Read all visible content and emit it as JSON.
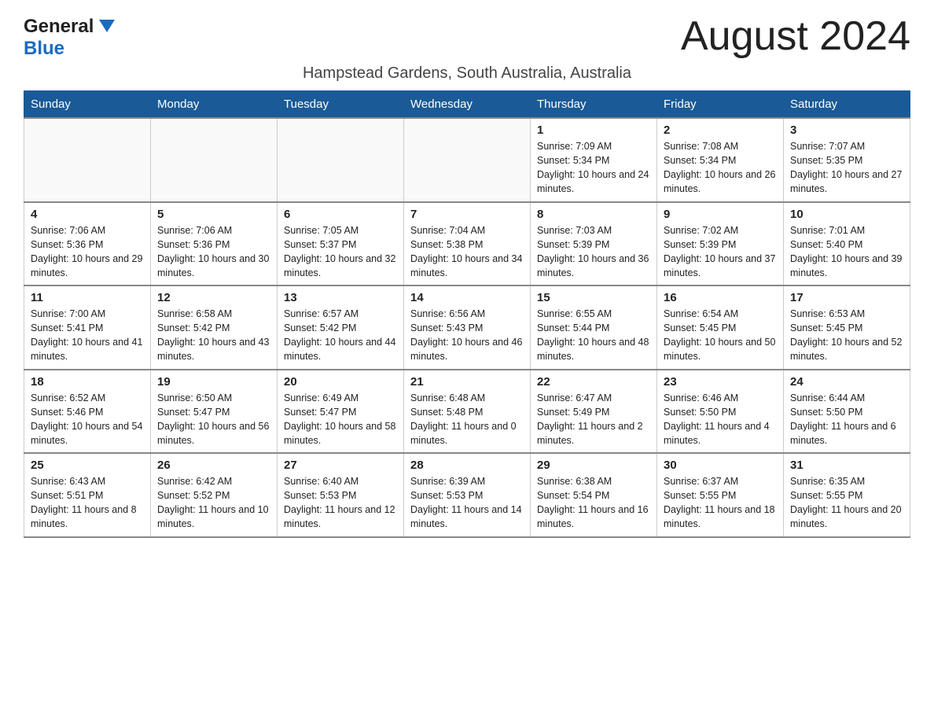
{
  "logo": {
    "text_general": "General",
    "text_blue": "Blue"
  },
  "header": {
    "month_year": "August 2024",
    "location": "Hampstead Gardens, South Australia, Australia"
  },
  "days_of_week": [
    "Sunday",
    "Monday",
    "Tuesday",
    "Wednesday",
    "Thursday",
    "Friday",
    "Saturday"
  ],
  "weeks": [
    {
      "days": [
        {
          "num": "",
          "info": ""
        },
        {
          "num": "",
          "info": ""
        },
        {
          "num": "",
          "info": ""
        },
        {
          "num": "",
          "info": ""
        },
        {
          "num": "1",
          "info": "Sunrise: 7:09 AM\nSunset: 5:34 PM\nDaylight: 10 hours and 24 minutes."
        },
        {
          "num": "2",
          "info": "Sunrise: 7:08 AM\nSunset: 5:34 PM\nDaylight: 10 hours and 26 minutes."
        },
        {
          "num": "3",
          "info": "Sunrise: 7:07 AM\nSunset: 5:35 PM\nDaylight: 10 hours and 27 minutes."
        }
      ]
    },
    {
      "days": [
        {
          "num": "4",
          "info": "Sunrise: 7:06 AM\nSunset: 5:36 PM\nDaylight: 10 hours and 29 minutes."
        },
        {
          "num": "5",
          "info": "Sunrise: 7:06 AM\nSunset: 5:36 PM\nDaylight: 10 hours and 30 minutes."
        },
        {
          "num": "6",
          "info": "Sunrise: 7:05 AM\nSunset: 5:37 PM\nDaylight: 10 hours and 32 minutes."
        },
        {
          "num": "7",
          "info": "Sunrise: 7:04 AM\nSunset: 5:38 PM\nDaylight: 10 hours and 34 minutes."
        },
        {
          "num": "8",
          "info": "Sunrise: 7:03 AM\nSunset: 5:39 PM\nDaylight: 10 hours and 36 minutes."
        },
        {
          "num": "9",
          "info": "Sunrise: 7:02 AM\nSunset: 5:39 PM\nDaylight: 10 hours and 37 minutes."
        },
        {
          "num": "10",
          "info": "Sunrise: 7:01 AM\nSunset: 5:40 PM\nDaylight: 10 hours and 39 minutes."
        }
      ]
    },
    {
      "days": [
        {
          "num": "11",
          "info": "Sunrise: 7:00 AM\nSunset: 5:41 PM\nDaylight: 10 hours and 41 minutes."
        },
        {
          "num": "12",
          "info": "Sunrise: 6:58 AM\nSunset: 5:42 PM\nDaylight: 10 hours and 43 minutes."
        },
        {
          "num": "13",
          "info": "Sunrise: 6:57 AM\nSunset: 5:42 PM\nDaylight: 10 hours and 44 minutes."
        },
        {
          "num": "14",
          "info": "Sunrise: 6:56 AM\nSunset: 5:43 PM\nDaylight: 10 hours and 46 minutes."
        },
        {
          "num": "15",
          "info": "Sunrise: 6:55 AM\nSunset: 5:44 PM\nDaylight: 10 hours and 48 minutes."
        },
        {
          "num": "16",
          "info": "Sunrise: 6:54 AM\nSunset: 5:45 PM\nDaylight: 10 hours and 50 minutes."
        },
        {
          "num": "17",
          "info": "Sunrise: 6:53 AM\nSunset: 5:45 PM\nDaylight: 10 hours and 52 minutes."
        }
      ]
    },
    {
      "days": [
        {
          "num": "18",
          "info": "Sunrise: 6:52 AM\nSunset: 5:46 PM\nDaylight: 10 hours and 54 minutes."
        },
        {
          "num": "19",
          "info": "Sunrise: 6:50 AM\nSunset: 5:47 PM\nDaylight: 10 hours and 56 minutes."
        },
        {
          "num": "20",
          "info": "Sunrise: 6:49 AM\nSunset: 5:47 PM\nDaylight: 10 hours and 58 minutes."
        },
        {
          "num": "21",
          "info": "Sunrise: 6:48 AM\nSunset: 5:48 PM\nDaylight: 11 hours and 0 minutes."
        },
        {
          "num": "22",
          "info": "Sunrise: 6:47 AM\nSunset: 5:49 PM\nDaylight: 11 hours and 2 minutes."
        },
        {
          "num": "23",
          "info": "Sunrise: 6:46 AM\nSunset: 5:50 PM\nDaylight: 11 hours and 4 minutes."
        },
        {
          "num": "24",
          "info": "Sunrise: 6:44 AM\nSunset: 5:50 PM\nDaylight: 11 hours and 6 minutes."
        }
      ]
    },
    {
      "days": [
        {
          "num": "25",
          "info": "Sunrise: 6:43 AM\nSunset: 5:51 PM\nDaylight: 11 hours and 8 minutes."
        },
        {
          "num": "26",
          "info": "Sunrise: 6:42 AM\nSunset: 5:52 PM\nDaylight: 11 hours and 10 minutes."
        },
        {
          "num": "27",
          "info": "Sunrise: 6:40 AM\nSunset: 5:53 PM\nDaylight: 11 hours and 12 minutes."
        },
        {
          "num": "28",
          "info": "Sunrise: 6:39 AM\nSunset: 5:53 PM\nDaylight: 11 hours and 14 minutes."
        },
        {
          "num": "29",
          "info": "Sunrise: 6:38 AM\nSunset: 5:54 PM\nDaylight: 11 hours and 16 minutes."
        },
        {
          "num": "30",
          "info": "Sunrise: 6:37 AM\nSunset: 5:55 PM\nDaylight: 11 hours and 18 minutes."
        },
        {
          "num": "31",
          "info": "Sunrise: 6:35 AM\nSunset: 5:55 PM\nDaylight: 11 hours and 20 minutes."
        }
      ]
    }
  ]
}
